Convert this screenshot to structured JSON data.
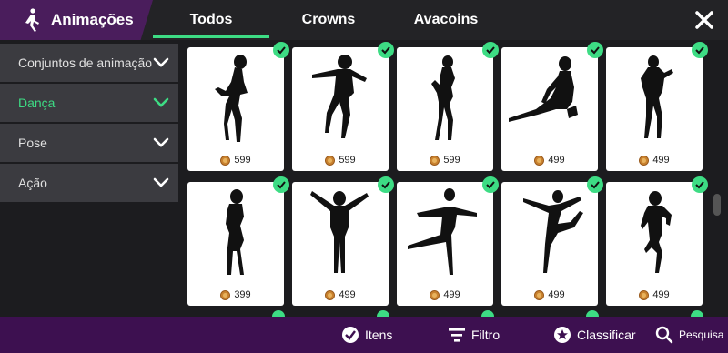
{
  "header": {
    "title": "Animações",
    "tabs": [
      {
        "label": "Todos",
        "active": true
      },
      {
        "label": "Crowns",
        "active": false
      },
      {
        "label": "Avacoins",
        "active": false
      }
    ],
    "close_icon": "close-icon"
  },
  "sidebar": {
    "items": [
      {
        "label": "Conjuntos de animação",
        "active": false
      },
      {
        "label": "Dança",
        "active": true
      },
      {
        "label": "Pose",
        "active": false
      },
      {
        "label": "Ação",
        "active": false
      }
    ]
  },
  "grid": {
    "items": [
      {
        "price": "599",
        "owned": true
      },
      {
        "price": "599",
        "owned": true
      },
      {
        "price": "599",
        "owned": true
      },
      {
        "price": "499",
        "owned": true
      },
      {
        "price": "499",
        "owned": true
      },
      {
        "price": "399",
        "owned": true
      },
      {
        "price": "499",
        "owned": true
      },
      {
        "price": "499",
        "owned": true
      },
      {
        "price": "499",
        "owned": true
      },
      {
        "price": "499",
        "owned": true
      }
    ]
  },
  "bottom_bar": {
    "items_label": "Itens",
    "filter_label": "Filtro",
    "sort_label": "Classificar",
    "search_label": "Pesquisa"
  },
  "colors": {
    "accent": "#3ddc84",
    "header_tab": "#4a1d5c",
    "bottom_bar": "#3d1050",
    "coin": "#c9822f"
  }
}
